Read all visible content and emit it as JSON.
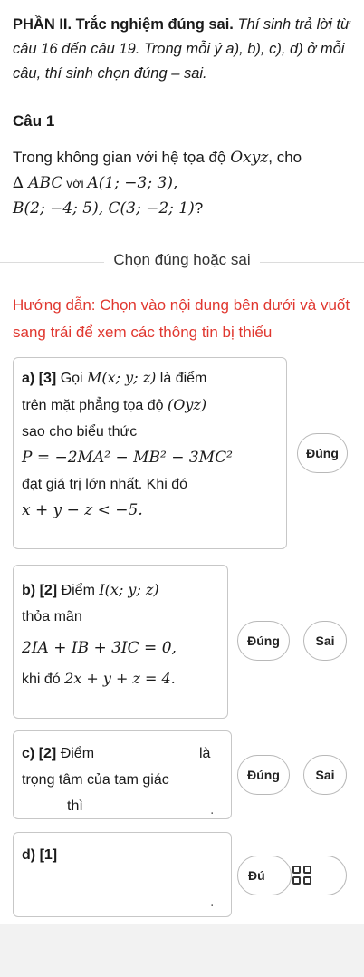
{
  "heading": {
    "part": "PHẦN II. Trắc nghiệm đúng sai.",
    "text": " Thí sinh trả lời từ câu 16 đến câu 19. Trong mỗi ý a), b), c), d) ở mỗi câu, thí sinh chọn đúng – sai."
  },
  "question": {
    "title": "Câu 1",
    "line1_prefix": "Trong không gian với hệ tọa độ ",
    "line1_math": "Oxyz",
    "line1_suffix": ", cho",
    "triangle": "∆ ABC",
    "with": " với ",
    "pointA": "A(1; −3; 3),",
    "pointB": "B(2; −4; 5), C(3; −2; 1)",
    "qmark": "?"
  },
  "choose_label": "Chọn đúng hoặc sai",
  "guide": "Hướng dẫn: Chọn vào nội dung bên dưới và vuốt sang trái để xem các thông tin bị thiếu",
  "items": {
    "a": {
      "label": "a)",
      "points": "[3]",
      "text1": " Gọi ",
      "math1": "M(x; y; z)",
      "text2": " là điểm",
      "text3": "trên mặt phẳng tọa độ ",
      "math2": "(Oyz)",
      "text4": "sao cho biểu thức",
      "formula": "P = −2MA² − MB² − 3MC²",
      "text5": "đạt giá trị lớn nhất. Khi đó",
      "formula2": "x + y − z < −5.",
      "btn_true": "Đúng"
    },
    "b": {
      "label": "b)",
      "points": "[2]",
      "text1": " Điểm ",
      "math1": "I(x; y; z)",
      "text2": "thỏa mãn",
      "formula": "2IA + IB + 3IC = 0,",
      "text3": "khi đó ",
      "formula2": "2x + y + z = 4.",
      "btn_true": "Đúng",
      "btn_false": "Sai"
    },
    "c": {
      "label": "c)",
      "points": "[2]",
      "text1": " Điểm",
      "text2": "là",
      "text3": "trọng tâm của tam giác",
      "text4": "thì",
      "dot": ".",
      "btn_true": "Đúng",
      "btn_false": "Sai"
    },
    "d": {
      "label": "d)",
      "points": "[1]",
      "dot": ".",
      "btn_true": "Đú"
    }
  }
}
